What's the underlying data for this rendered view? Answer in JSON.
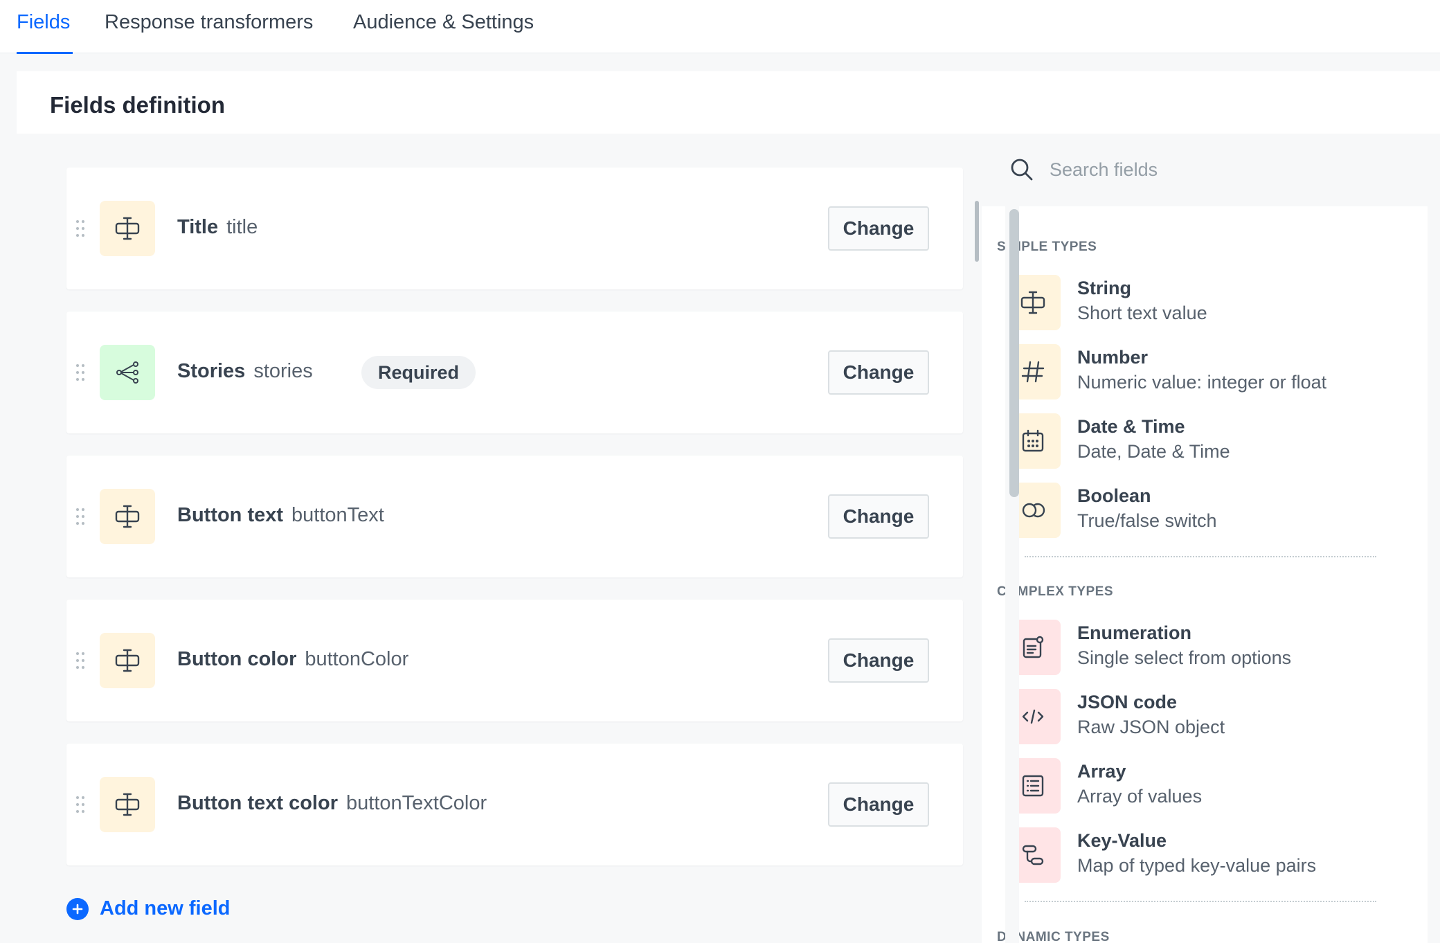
{
  "tabs": [
    {
      "label": "Fields",
      "active": true
    },
    {
      "label": "Response transformers",
      "active": false
    },
    {
      "label": "Audience & Settings",
      "active": false
    }
  ],
  "panel": {
    "title": "Fields definition"
  },
  "fields": [
    {
      "name": "Title",
      "key": "title",
      "icon": "text-field-icon",
      "change_label": "Change"
    },
    {
      "name": "Stories",
      "key": "stories",
      "icon": "share-nodes-icon",
      "badge": "Required",
      "change_label": "Change"
    },
    {
      "name": "Button text",
      "key": "buttonText",
      "icon": "text-field-icon",
      "change_label": "Change"
    },
    {
      "name": "Button color",
      "key": "buttonColor",
      "icon": "text-field-icon",
      "change_label": "Change"
    },
    {
      "name": "Button text color",
      "key": "buttonTextColor",
      "icon": "text-field-icon",
      "change_label": "Change"
    }
  ],
  "add_field": {
    "label": "Add new field"
  },
  "search": {
    "placeholder": "Search fields",
    "value": ""
  },
  "sections": {
    "simple": {
      "title": "SIMPLE TYPES",
      "items": [
        {
          "name": "String",
          "desc": "Short text value",
          "icon": "text-field-icon"
        },
        {
          "name": "Number",
          "desc": "Numeric value: integer or float",
          "icon": "hash-icon"
        },
        {
          "name": "Date & Time",
          "desc": "Date, Date & Time",
          "icon": "calendar-icon"
        },
        {
          "name": "Boolean",
          "desc": "True/false switch",
          "icon": "toggle-icon"
        }
      ]
    },
    "complex": {
      "title": "COMPLEX TYPES",
      "items": [
        {
          "name": "Enumeration",
          "desc": "Single select from options",
          "icon": "enum-list-icon"
        },
        {
          "name": "JSON code",
          "desc": "Raw JSON object",
          "icon": "code-icon"
        },
        {
          "name": "Array",
          "desc": "Array of values",
          "icon": "list-icon"
        },
        {
          "name": "Key-Value",
          "desc": "Map of typed key-value pairs",
          "icon": "key-value-icon"
        }
      ]
    },
    "dynamic": {
      "title": "DYNAMIC TYPES"
    }
  },
  "colors": {
    "accent": "#0b68ff",
    "icon_yellow_bg": "#fff4dd",
    "icon_green_bg": "#d7fcdd",
    "icon_pink_bg": "#ffe4e6"
  }
}
